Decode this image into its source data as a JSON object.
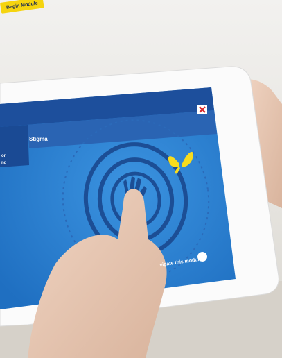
{
  "module_screen": {
    "header_title": "Stigma",
    "left_panel_partial_1": "on",
    "left_panel_partial_2": "nd",
    "navigate_label": "vigate this module",
    "begin_button_label": "Begin Module",
    "close_icon": "close-icon",
    "butterfly_icon": "butterfly-icon",
    "hand_icon": "hand-icon",
    "pointer_icon": "cursor-pointer-icon"
  },
  "colors": {
    "screen_blue": "#2f86d6",
    "header_navy": "#1d4f9c",
    "butterfly_yellow": "#f7dc1e",
    "button_yellow": "#f5d40f",
    "close_red": "#d7262b"
  }
}
